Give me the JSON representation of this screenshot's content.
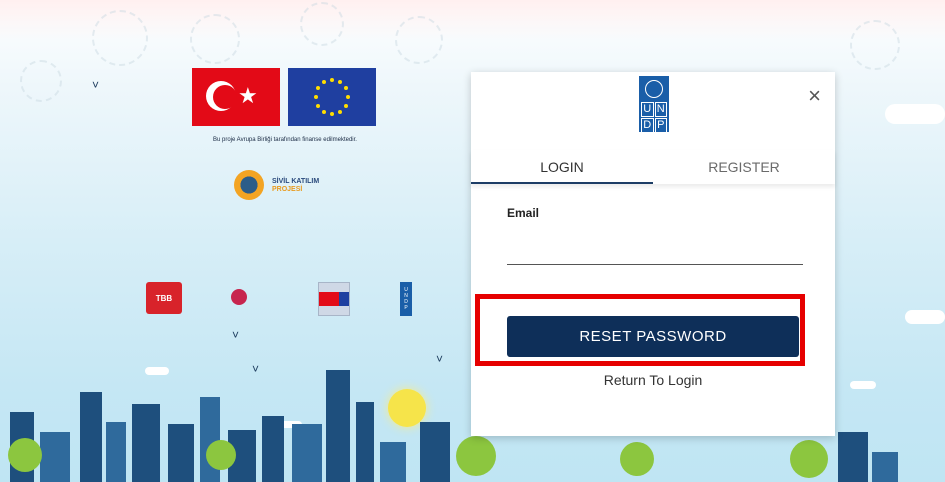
{
  "background": {
    "eu_note": "Bu proje Avrupa Birliği tarafından finanse edilmektedir.",
    "sivil_logo": {
      "line1": "SİVİL KATILIM",
      "line2": "PROJESİ"
    },
    "partners": {
      "tbb": "TBB",
      "undp_lines": [
        "U",
        "N",
        "D",
        "P"
      ]
    }
  },
  "modal": {
    "logo_letters": [
      "U",
      "N",
      "D",
      "P"
    ],
    "close_icon": "×",
    "tabs": [
      {
        "label": "LOGIN",
        "active": true
      },
      {
        "label": "REGISTER",
        "active": false
      }
    ],
    "email_label": "Email",
    "email_value": "",
    "reset_button": "RESET PASSWORD",
    "return_link": "Return To Login"
  },
  "colors": {
    "primary_button": "#0e2f59",
    "highlight_box": "#e60000",
    "undp_blue": "#1a5ea8"
  }
}
